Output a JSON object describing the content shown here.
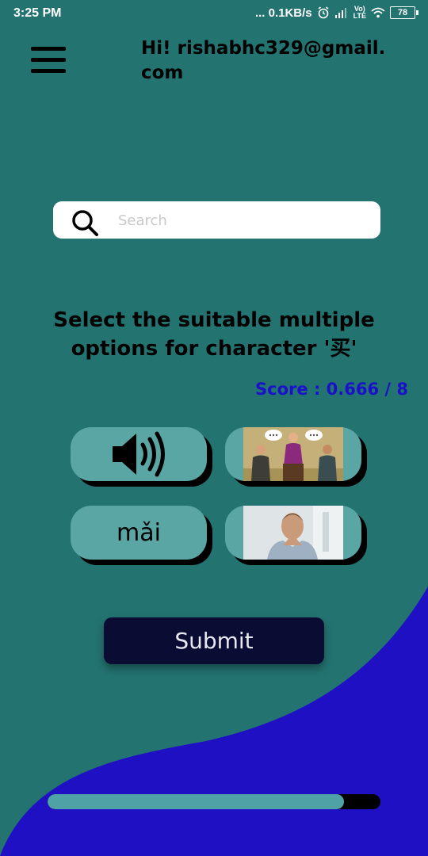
{
  "status_bar": {
    "time": "3:25 PM",
    "network_speed": "... 0.1KB/s",
    "battery": "78",
    "lte_top": "Vo)",
    "lte_bottom": "LTE",
    "icons": [
      "alarm-icon",
      "signal-icon",
      "lte-icon",
      "wifi-icon",
      "battery-icon"
    ]
  },
  "header": {
    "menu_icon": "hamburger-menu-icon",
    "greeting": "Hi! rishabhc329@gmail.com"
  },
  "search": {
    "placeholder": "Search",
    "value": "",
    "icon": "search-icon"
  },
  "question": {
    "text": "Select the suitable multiple options for character '买'"
  },
  "score": {
    "text": "Score : 0.666 / 8"
  },
  "options": [
    {
      "type": "audio",
      "icon": "speaker-icon"
    },
    {
      "type": "image",
      "icon": "people-meeting-image"
    },
    {
      "type": "text",
      "label": "mǎi"
    },
    {
      "type": "image",
      "icon": "thinking-man-image"
    }
  ],
  "submit": {
    "label": "Submit"
  },
  "progress": {
    "value": 0.89
  },
  "colors": {
    "background": "#237371",
    "wave": "#1f10c4",
    "option": "#5aa6a4",
    "submit": "#0a0c34",
    "score": "#1a11c9",
    "progress_fill": "#4fa3a7"
  }
}
